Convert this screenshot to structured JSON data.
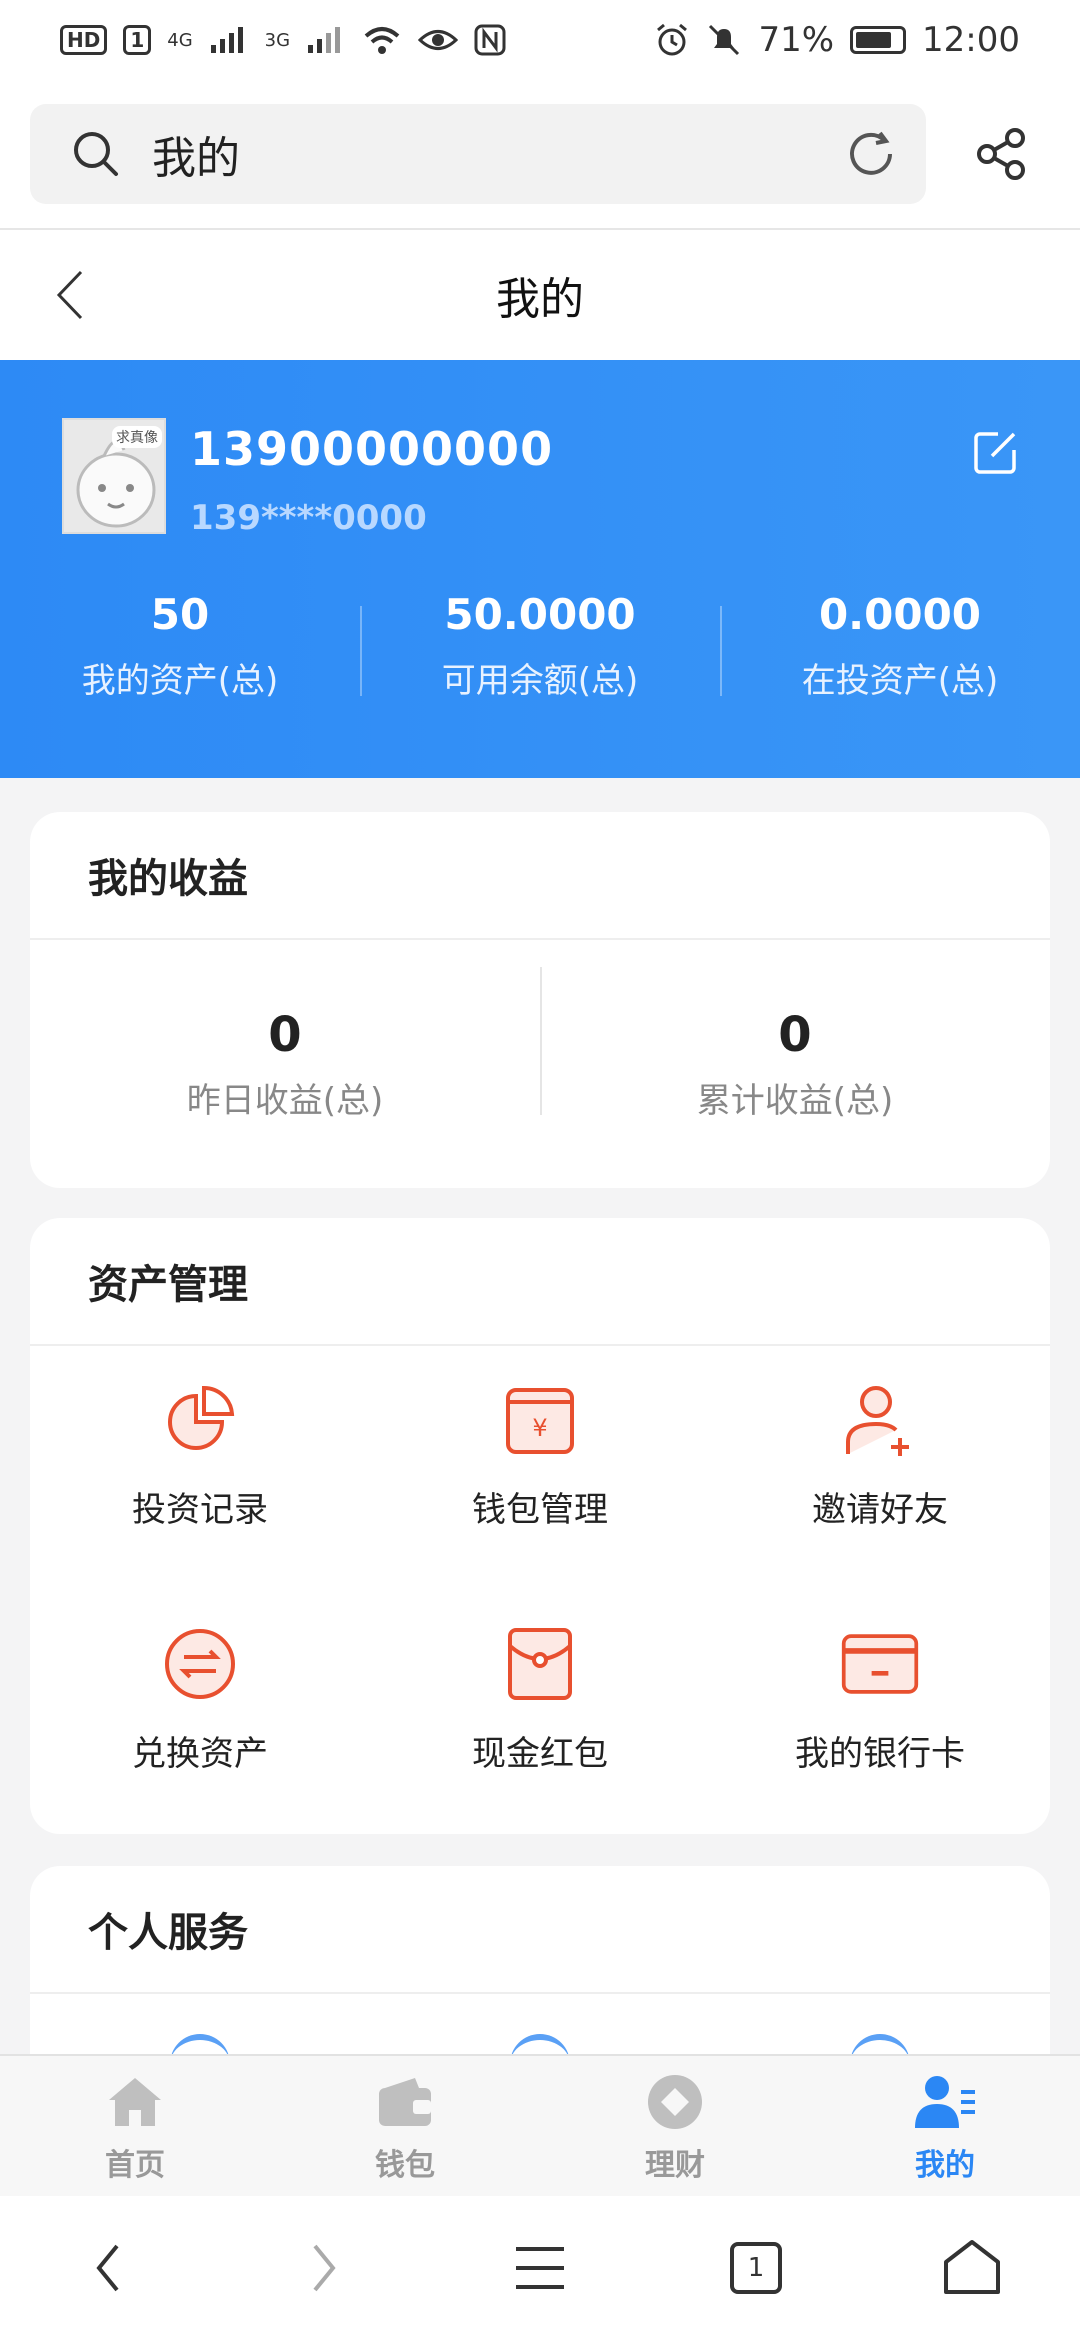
{
  "status_bar": {
    "left_badges": [
      "HD",
      "1"
    ],
    "signal_1": "4G",
    "signal_2": "3G",
    "battery_percent": "71%",
    "time": "12:00",
    "battery_level": 0.71
  },
  "browser": {
    "url_text": "我的",
    "tab_count": "1"
  },
  "header": {
    "title": "我的"
  },
  "profile": {
    "avatar_tag": "求真像",
    "phone": "13900000000",
    "phone_masked": "139****0000",
    "stats": [
      {
        "value": "50",
        "label": "我的资产(总)"
      },
      {
        "value": "50.0000",
        "label": "可用余额(总)"
      },
      {
        "value": "0.0000",
        "label": "在投资产(总)"
      }
    ]
  },
  "earnings": {
    "title": "我的收益",
    "items": [
      {
        "value": "0",
        "label": "昨日收益(总)"
      },
      {
        "value": "0",
        "label": "累计收益(总)"
      }
    ]
  },
  "assets": {
    "title": "资产管理",
    "items": [
      {
        "label": "投资记录",
        "icon": "pie-chart-icon"
      },
      {
        "label": "钱包管理",
        "icon": "wallet-yen-icon"
      },
      {
        "label": "邀请好友",
        "icon": "add-user-icon"
      },
      {
        "label": "兑换资产",
        "icon": "exchange-icon"
      },
      {
        "label": "现金红包",
        "icon": "red-envelope-icon"
      },
      {
        "label": "我的银行卡",
        "icon": "bank-card-icon"
      }
    ]
  },
  "personal": {
    "title": "个人服务"
  },
  "tabs": [
    {
      "label": "首页",
      "icon": "home-icon",
      "active": false
    },
    {
      "label": "钱包",
      "icon": "wallet-icon",
      "active": false
    },
    {
      "label": "理财",
      "icon": "finance-icon",
      "active": false
    },
    {
      "label": "我的",
      "icon": "profile-icon",
      "active": true
    }
  ],
  "colors": {
    "brand_blue": "#2d8af5",
    "accent_red": "#e8502f",
    "tab_active": "#2b87f4",
    "tab_inactive": "#999999"
  }
}
